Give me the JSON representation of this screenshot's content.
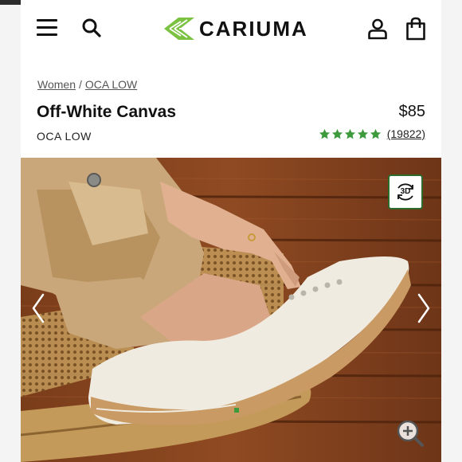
{
  "header": {
    "brand": "CARIUMA",
    "icons": [
      "hamburger-menu-icon",
      "search-icon",
      "account-icon",
      "shopping-bag-icon"
    ],
    "brand_color": "#7cc242"
  },
  "breadcrumb": {
    "items": [
      "Women",
      "OCA LOW"
    ],
    "separator": "/"
  },
  "product": {
    "title": "Off-White Canvas",
    "collection": "OCA LOW",
    "price": "$85",
    "rating_stars": 5,
    "review_count": "(19822)",
    "star_color": "#3d9a3d"
  },
  "gallery": {
    "view_3d_label": "3D",
    "accent_color": "#2d6b2a",
    "controls": [
      "previous-arrow-icon",
      "next-arrow-icon",
      "zoom-in-icon"
    ]
  }
}
